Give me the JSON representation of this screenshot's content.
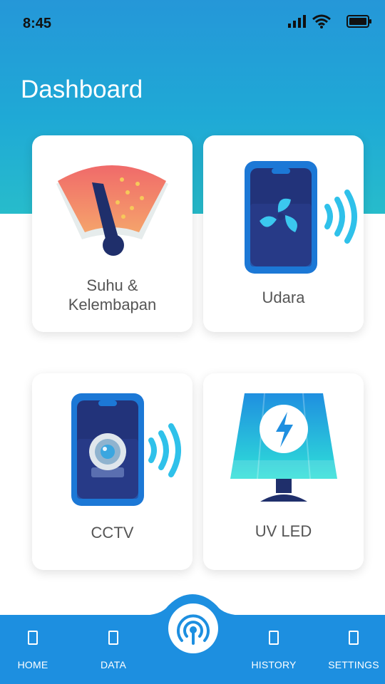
{
  "status_bar": {
    "time": "8:45"
  },
  "header": {
    "title": "Dashboard"
  },
  "cards": [
    {
      "label_line1": "Suhu &",
      "label_line2": "Kelembapan",
      "icon": "gauge-icon"
    },
    {
      "label": "Udara",
      "icon": "phone-fan-icon"
    },
    {
      "label": "CCTV",
      "icon": "phone-camera-icon"
    },
    {
      "label": "UV LED",
      "icon": "uv-lamp-icon"
    }
  ],
  "bottom_nav": {
    "items": [
      {
        "label": "HOME"
      },
      {
        "label": "DATA"
      },
      {
        "label": "HISTORY"
      },
      {
        "label": "SETTINGS"
      }
    ],
    "center_icon": "wireless-signal-icon"
  },
  "colors": {
    "header_top": "#2597d8",
    "header_bottom": "#27bccb",
    "nav_bar": "#1d8fe0",
    "card_label": "#555555"
  }
}
